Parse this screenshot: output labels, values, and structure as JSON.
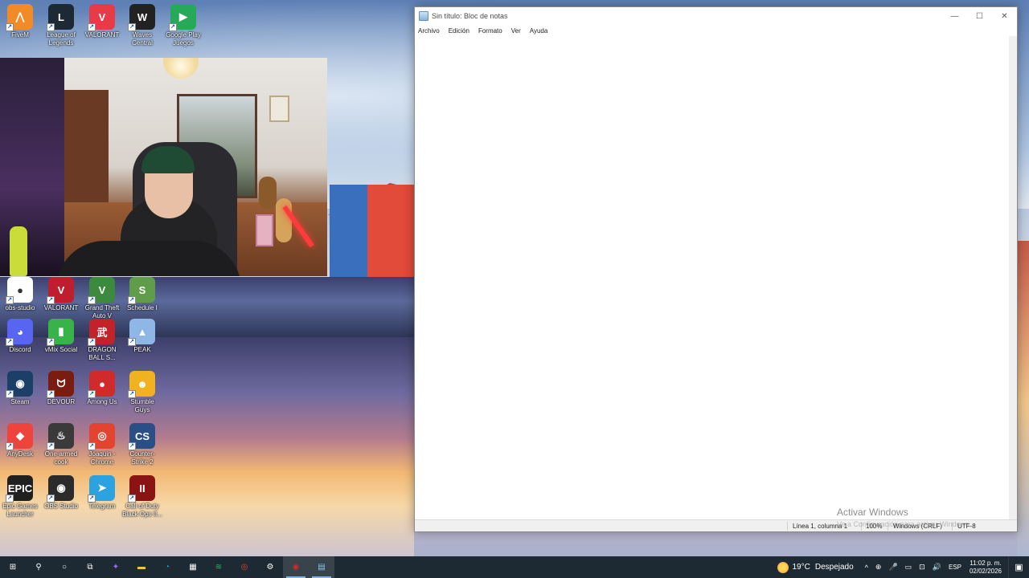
{
  "desktop_icons": [
    {
      "name": "fivem",
      "label": "FiveM",
      "glyph": "⋀",
      "color": "#f28a26",
      "row": 0,
      "col": 0
    },
    {
      "name": "league-of-legends",
      "label": "League of Legends",
      "glyph": "L",
      "color": "#1d2a36",
      "row": 0,
      "col": 1
    },
    {
      "name": "valorant-top",
      "label": "VALORANT",
      "glyph": "V",
      "color": "#e83b48",
      "row": 0,
      "col": 2
    },
    {
      "name": "waves-central",
      "label": "Waves Central",
      "glyph": "W",
      "color": "#222222",
      "row": 0,
      "col": 3
    },
    {
      "name": "google-play-juegos",
      "label": "Google Play Juegos",
      "glyph": "▶",
      "color": "#27a95a",
      "row": 0,
      "col": 4
    },
    {
      "name": "obs-studio-top",
      "label": "obs-studio",
      "glyph": "●",
      "color": "#ffffff",
      "row": 1,
      "col": 0
    },
    {
      "name": "valorant-mid",
      "label": "VALORANT",
      "glyph": "V",
      "color": "#bf1e2e",
      "row": 1,
      "col": 1
    },
    {
      "name": "gta-v",
      "label": "Grand Theft Auto V",
      "glyph": "V",
      "color": "#3b8a3e",
      "row": 1,
      "col": 2
    },
    {
      "name": "schedule-1",
      "label": "Schedule I",
      "glyph": "S",
      "color": "#5f9d4a",
      "row": 1,
      "col": 3
    },
    {
      "name": "discord",
      "label": "Discord",
      "glyph": "◕",
      "color": "#5865f2",
      "row": 2,
      "col": 0
    },
    {
      "name": "vmix-social",
      "label": "vMix Social",
      "glyph": "▮",
      "color": "#37b34a",
      "row": 2,
      "col": 1
    },
    {
      "name": "dragon-ball",
      "label": "DRAGON BALL S...",
      "glyph": "武",
      "color": "#c2222a",
      "row": 2,
      "col": 2
    },
    {
      "name": "peak",
      "label": "PEAK",
      "glyph": "▲",
      "color": "#8fb7e6",
      "row": 2,
      "col": 3
    },
    {
      "name": "steam",
      "label": "Steam",
      "glyph": "◉",
      "color": "#1b3f66",
      "row": 3,
      "col": 0
    },
    {
      "name": "devour",
      "label": "DEVOUR",
      "glyph": "ᗢ",
      "color": "#7a1c10",
      "row": 3,
      "col": 1
    },
    {
      "name": "among-us",
      "label": "Among Us",
      "glyph": "●",
      "color": "#d12a2a",
      "row": 3,
      "col": 2
    },
    {
      "name": "stumble-guys",
      "label": "Stumble Guys",
      "glyph": "☻",
      "color": "#f0b21e",
      "row": 3,
      "col": 3
    },
    {
      "name": "anydesk",
      "label": "AnyDesk",
      "glyph": "◆",
      "color": "#ef443b",
      "row": 4,
      "col": 0
    },
    {
      "name": "one-armed-cook",
      "label": "One-armed cook",
      "glyph": "♨",
      "color": "#3a3a3a",
      "row": 4,
      "col": 1
    },
    {
      "name": "joaquin-chrome",
      "label": "Joaquin - Chrome",
      "glyph": "◎",
      "color": "#e4442f",
      "row": 4,
      "col": 2
    },
    {
      "name": "counter-strike-2",
      "label": "Counter-Strike 2",
      "glyph": "CS",
      "color": "#2a4f86",
      "row": 4,
      "col": 3
    },
    {
      "name": "epic-games",
      "label": "Epic Games Launcher",
      "glyph": "EPIC",
      "color": "#202020",
      "row": 5,
      "col": 0
    },
    {
      "name": "obs-studio",
      "label": "OBS Studio",
      "glyph": "◉",
      "color": "#2b2b2b",
      "row": 5,
      "col": 1
    },
    {
      "name": "telegram",
      "label": "Telegram",
      "glyph": "➤",
      "color": "#2aa3e0",
      "row": 5,
      "col": 2
    },
    {
      "name": "call-of-duty",
      "label": "Call of Duty Black Ops II...",
      "glyph": "II",
      "color": "#8a1414",
      "row": 5,
      "col": 3
    }
  ],
  "notepad": {
    "title": "Sin título: Bloc de notas",
    "menu": [
      "Archivo",
      "Edición",
      "Formato",
      "Ver",
      "Ayuda"
    ],
    "content": "",
    "controls": {
      "minimize": "—",
      "maximize": "☐",
      "close": "✕"
    },
    "status": {
      "position": "Línea 1, columna 1",
      "zoom": "100%",
      "line_ending": "Windows (CRLF)",
      "encoding": "UTF-8"
    }
  },
  "activation": {
    "title": "Activar Windows",
    "subtitle": "Ve a Configuración para activar Windows."
  },
  "taskbar": {
    "apps": [
      {
        "name": "start-button",
        "glyph": "⊞",
        "color": "#ffffff"
      },
      {
        "name": "search-button",
        "glyph": "⚲",
        "color": "#ffffff"
      },
      {
        "name": "cortana-button",
        "glyph": "○",
        "color": "#ffffff"
      },
      {
        "name": "task-view-button",
        "glyph": "⧉",
        "color": "#ffffff"
      },
      {
        "name": "copilot-button",
        "glyph": "✦",
        "color": "#9b6bff"
      },
      {
        "name": "file-explorer-button",
        "glyph": "▬",
        "color": "#f2c23c"
      },
      {
        "name": "edge-button",
        "glyph": "◔",
        "color": "#1c9bd8"
      },
      {
        "name": "store-button",
        "glyph": "▦",
        "color": "#ffffff"
      },
      {
        "name": "spotify-button",
        "glyph": "≋",
        "color": "#1db954"
      },
      {
        "name": "chrome-button",
        "glyph": "◎",
        "color": "#e4442f"
      },
      {
        "name": "settings-button",
        "glyph": "⚙",
        "color": "#ffffff"
      },
      {
        "name": "obs-button",
        "glyph": "◉",
        "color": "#d12a2a"
      },
      {
        "name": "notepad-button",
        "glyph": "▤",
        "color": "#8fc3ea"
      }
    ],
    "weather": {
      "temperature": "19°C",
      "condition": "Despejado"
    },
    "tray_icons": [
      "^",
      "⊕",
      "🎤",
      "▭",
      "⊡",
      "🔊"
    ],
    "language": "ESP",
    "time": "11:02 p. m.",
    "date": "02/02/2026",
    "notification_glyph": "▣"
  }
}
